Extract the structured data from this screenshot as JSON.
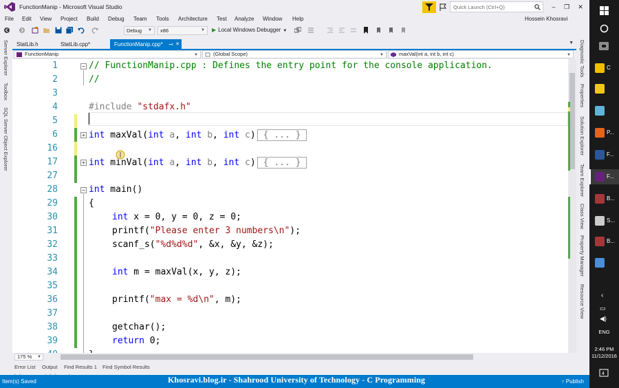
{
  "window": {
    "title": "FunctionManip - Microsoft Visual Studio",
    "quick_launch_placeholder": "Quick Launch (Ctrl+Q)",
    "user_name": "Hossein Khosravi"
  },
  "menu": [
    "File",
    "Edit",
    "View",
    "Project",
    "Build",
    "Debug",
    "Team",
    "Tools",
    "Architecture",
    "Test",
    "Analyze",
    "Window",
    "Help"
  ],
  "toolbar": {
    "configuration": "Debug",
    "platform": "x86",
    "run_label": "Local Windows Debugger"
  },
  "left_panel_tabs": [
    "Server Explorer",
    "Toolbox",
    "SQL Server Object Explorer"
  ],
  "right_panel_tabs": [
    "Diagnostic Tools",
    "Properties",
    "Solution Explorer",
    "Team Explorer",
    "Class View",
    "Property Manager",
    "Resource View"
  ],
  "doc_tabs": [
    "StatLib.h",
    "StatLib.cpp*",
    "FunctionManip.cpp*"
  ],
  "doc_tab_close": "✕",
  "navbar": {
    "project": "FunctionManip",
    "scope": "(Global Scope)",
    "member": "maxVal(int a, int b, int c)"
  },
  "editor": {
    "zoom": "175 %",
    "lines": [
      {
        "n": "1",
        "text": "// FunctionManip.cpp : Defines the entry point for the console application."
      },
      {
        "n": "2",
        "text": "//"
      },
      {
        "n": "3",
        "text": ""
      },
      {
        "n": "4",
        "text": "#include \"stdafx.h\""
      },
      {
        "n": "5",
        "text": ""
      },
      {
        "n": "6",
        "text": "int maxVal(int a, int b, int c)",
        "collapsed": "{ ... }"
      },
      {
        "n": "16",
        "text": ""
      },
      {
        "n": "17",
        "text": "int minVal(int a, int b, int c)",
        "collapsed": "{ ... }"
      },
      {
        "n": "27",
        "text": ""
      },
      {
        "n": "28",
        "text": "int main()"
      },
      {
        "n": "29",
        "text": "{"
      },
      {
        "n": "30",
        "text": "int x = 0, y = 0, z = 0;"
      },
      {
        "n": "31",
        "text": "printf(\"Please enter 3 numbers\\n\");"
      },
      {
        "n": "32",
        "text": "scanf_s(\"%d%d%d\", &x, &y, &z);"
      },
      {
        "n": "33",
        "text": ""
      },
      {
        "n": "34",
        "text": "int m = maxVal(x, y, z);"
      },
      {
        "n": "35",
        "text": ""
      },
      {
        "n": "36",
        "text": "printf(\"max = %d\\n\", m);"
      },
      {
        "n": "37",
        "text": ""
      },
      {
        "n": "38",
        "text": "getchar();"
      },
      {
        "n": "39",
        "text": "return 0;"
      },
      {
        "n": "40",
        "text": "}"
      }
    ]
  },
  "bottom_tabs": [
    "Error List",
    "Output",
    "Find Results 1",
    "Find Symbol Results"
  ],
  "status": {
    "left": "Item(s) Saved",
    "publish": "↑ Publish",
    "watermark": "Khosravi.blog.ir  -  Shahrood University of Technology  -  C Programming",
    "watermark_ghost": "khosravi.blog.ir"
  },
  "taskbar": {
    "items": [
      {
        "label": "C",
        "color": "#f0c000"
      },
      {
        "label": "",
        "color": "#f2c811"
      },
      {
        "label": "",
        "color": "#5fb5d8"
      },
      {
        "label": "P...",
        "color": "#e8631a"
      },
      {
        "label": "F...",
        "color": "#2b579a"
      },
      {
        "label": "F...",
        "color": "#68217a"
      },
      {
        "label": "B...",
        "color": "#a4373a"
      },
      {
        "label": "S...",
        "color": "#cccccc"
      },
      {
        "label": "B...",
        "color": "#a4373a"
      },
      {
        "label": "",
        "color": "#4a8fd9"
      }
    ],
    "language": "ENG",
    "time": "2:46 PM",
    "date": "11/12/2016",
    "notifications": "4"
  },
  "colors": {
    "accent": "#007acc",
    "keyword": "#0000ff",
    "comment": "#008000",
    "string": "#a31515",
    "line_number": "#2b91af",
    "change_saved": "#57a64a",
    "change_unsaved": "#efef7d"
  }
}
